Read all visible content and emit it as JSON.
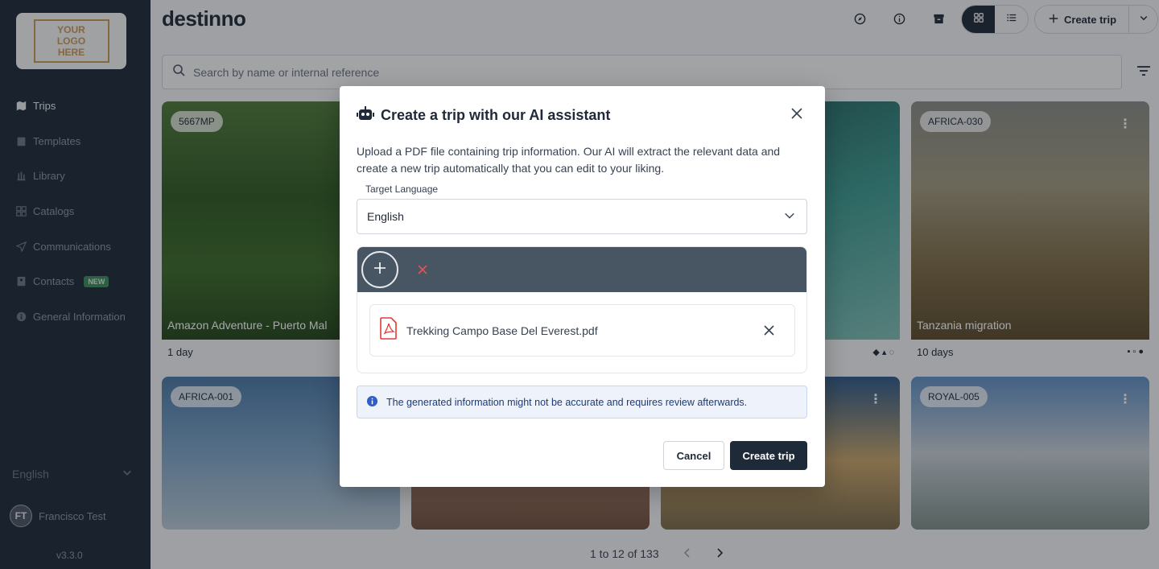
{
  "brand": "destinno",
  "logo": {
    "text": "YOUR LOGO HERE"
  },
  "sidebar": {
    "items": [
      {
        "label": "Trips",
        "icon": "map-icon",
        "active": true
      },
      {
        "label": "Templates",
        "icon": "clipboard-icon"
      },
      {
        "label": "Library",
        "icon": "library-icon"
      },
      {
        "label": "Catalogs",
        "icon": "grid-icon"
      },
      {
        "label": "Communications",
        "icon": "send-icon"
      },
      {
        "label": "Contacts",
        "icon": "contacts-icon",
        "badge": "NEW"
      },
      {
        "label": "General Information",
        "icon": "info-icon"
      }
    ],
    "language": "English",
    "user": {
      "initials": "FT",
      "name": "Francisco Test"
    },
    "version": "v3.3.0"
  },
  "header": {
    "create_label": "Create trip"
  },
  "search": {
    "placeholder": "Search by name or internal reference"
  },
  "cards": [
    {
      "code": "5667MP",
      "title": "Amazon Adventure - Puerto Mal",
      "duration": "1 day"
    },
    {
      "code": "AFRICA-030",
      "title": "Tanzania migration",
      "duration": "10 days"
    },
    {
      "code": "AFRICA-001"
    },
    {
      "code": "ROYAL-005"
    }
  ],
  "pagination": {
    "summary": "1 to 12 of 133"
  },
  "modal": {
    "title": "Create a trip with our AI assistant",
    "description": "Upload a PDF file containing trip information. Our AI will extract the relevant data and create a new trip automatically that you can edit to your liking.",
    "language_label": "Target Language",
    "language_value": "English",
    "file_name": "Trekking Campo Base Del Everest.pdf",
    "info": "The generated information might not be accurate and requires review afterwards.",
    "cancel_label": "Cancel",
    "create_label": "Create trip"
  },
  "colors": {
    "primary": "#1e2a38",
    "accent": "#c79a5a",
    "upload_bar": "#485563",
    "info_bg": "#eef3fb"
  }
}
